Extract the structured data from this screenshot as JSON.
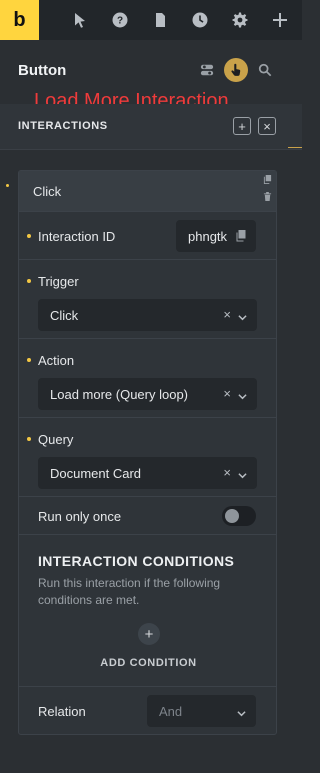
{
  "toolbar": {
    "logo": "b",
    "icons": [
      "cursor-icon",
      "help-icon",
      "page-icon",
      "history-icon",
      "gear-icon",
      "plus-icon"
    ]
  },
  "panel": {
    "title": "Button",
    "annotation": "Load More Interaction"
  },
  "section": {
    "title": "INTERACTIONS",
    "add_label": "+",
    "close_label": "×"
  },
  "interaction": {
    "header_label": "Click",
    "id_label": "Interaction ID",
    "id_value": "phngtk",
    "trigger_label": "Trigger",
    "trigger_value": "Click",
    "action_label": "Action",
    "action_value": "Load more (Query loop)",
    "query_label": "Query",
    "query_value": "Document Card",
    "run_once_label": "Run only once",
    "run_once_value": false,
    "clear_glyph": "×"
  },
  "conditions": {
    "title": "INTERACTION CONDITIONS",
    "description": "Run this interaction if the following conditions are met.",
    "add_glyph": "+",
    "add_label": "ADD CONDITION",
    "relation_label": "Relation",
    "relation_placeholder": "And"
  },
  "colors": {
    "brand": "#ffd53e",
    "annotation": "#ef3b3b",
    "active_icon": "#c9a24a"
  }
}
